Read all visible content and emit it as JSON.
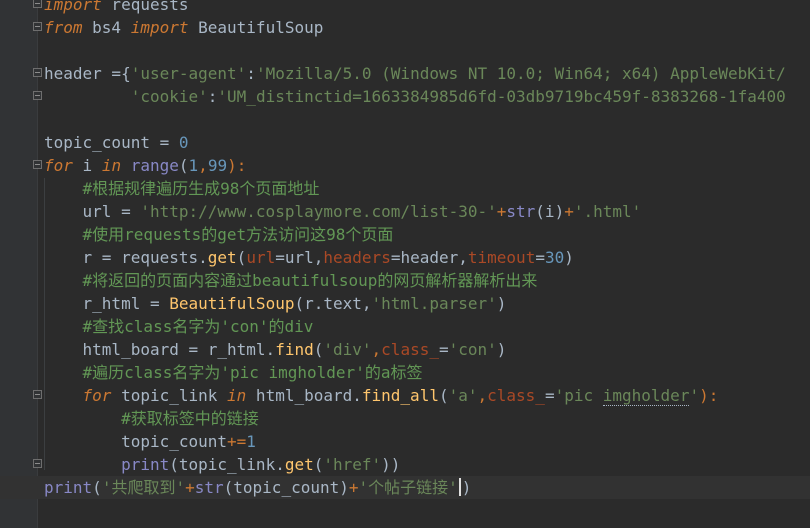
{
  "colors": {
    "background": "#2b2b2b",
    "gutter": "#313335",
    "keyword": "#cc7832",
    "string": "#6a8759",
    "number": "#6897bb",
    "comment": "#629755",
    "builtin": "#8888c6",
    "parameter": "#aa4926",
    "default": "#a9b7c6"
  },
  "icons": [
    "fold-marker-icon",
    "text-caret"
  ],
  "code": {
    "l1": [
      "import",
      " requests"
    ],
    "l2": [
      "from",
      " bs4 ",
      "import",
      " BeautifulSoup"
    ],
    "l4": [
      "header =",
      "{",
      "'user-agent'",
      ":",
      "'Mozilla/5.0 (Windows NT 10.0; Win64; x64) AppleWebKit/"
    ],
    "l5": [
      "         ",
      "'cookie'",
      ":",
      "'UM_distinctid=1663384985d6fd-03db9719bc459f-8383268-1fa400"
    ],
    "l7": [
      "topic_count = ",
      "0"
    ],
    "l8": [
      "for",
      " i ",
      "in",
      " ",
      "range",
      "(",
      "1",
      ",",
      "99",
      "):"
    ],
    "l9": [
      "    ",
      "#根据规律遍历生成98个页面地址"
    ],
    "l10": [
      "    url = ",
      "'http://www.cosplaymore.com/list-30-'",
      "+",
      "str",
      "(i)",
      "+",
      "'.html'"
    ],
    "l11": [
      "    ",
      "#使用requests的get方法访问这98个页面"
    ],
    "l12": [
      "    r = requests.",
      "get",
      "(",
      "url",
      "=url,",
      "headers",
      "=header,",
      "timeout",
      "=",
      "30",
      ")"
    ],
    "l13": [
      "    ",
      "#将返回的页面内容通过beautifulsoup的网页解析器解析出来"
    ],
    "l14": [
      "    r_html = ",
      "BeautifulSoup",
      "(r.text,",
      "'html.parser'",
      ")"
    ],
    "l15": [
      "    ",
      "#查找class名字为'con'的div"
    ],
    "l16": [
      "    html_board = r_html.",
      "find",
      "(",
      "'div'",
      ",",
      "class_",
      "=",
      "'con'",
      ")"
    ],
    "l17": [
      "    ",
      "#遍历class名字为'pic imgholder'的a标签"
    ],
    "l18": [
      "    ",
      "for",
      " topic_link ",
      "in",
      " html_board.",
      "find_all",
      "(",
      "'a'",
      ",",
      "class_",
      "=",
      "'pic ",
      "imgholder",
      "'",
      "):"
    ],
    "l19": [
      "        ",
      "#获取标签中的链接"
    ],
    "l20": [
      "        topic_count",
      "+=",
      "1"
    ],
    "l21": [
      "        ",
      "print",
      "(topic_link.",
      "get",
      "(",
      "'href'",
      "))"
    ],
    "l22": [
      "print",
      "(",
      "'共爬取到'",
      "+",
      "str",
      "(topic_count)",
      "+",
      "'个帖子链接'",
      ")"
    ]
  }
}
